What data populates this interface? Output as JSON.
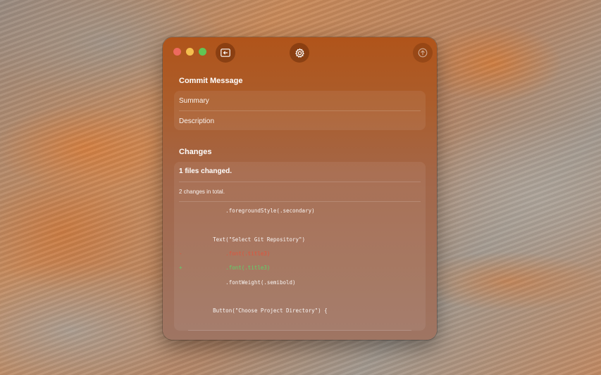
{
  "window": {
    "toolbar_icons": {
      "open_repo": "folder-arrow-icon",
      "settings": "gear-icon",
      "push": "arrow-up-circle-icon"
    }
  },
  "commit": {
    "section_title": "Commit Message",
    "summary_placeholder": "Summary",
    "description_placeholder": "Description"
  },
  "changes": {
    "section_title": "Changes",
    "files_changed": "1 files changed.",
    "total": "2 changes in total.",
    "diff": [
      {
        "marker": "",
        "type": "context",
        "text": "            .foregroundStyle(.secondary)"
      },
      {
        "marker": "",
        "type": "context",
        "text": ""
      },
      {
        "marker": "",
        "type": "context",
        "text": "        Text(\"Select Git Repository\")"
      },
      {
        "marker": "-",
        "type": "removed",
        "text": "            .font(.title3)"
      },
      {
        "marker": "+",
        "type": "added",
        "text": "            .font(.title3)"
      },
      {
        "marker": "",
        "type": "context",
        "text": "            .fontWeight(.semibold)"
      },
      {
        "marker": "",
        "type": "context",
        "text": ""
      },
      {
        "marker": "",
        "type": "context",
        "text": "        Button(\"Choose Project Directory\") {"
      }
    ]
  },
  "colors": {
    "added": "#5bd46a",
    "removed": "#e0533c"
  }
}
